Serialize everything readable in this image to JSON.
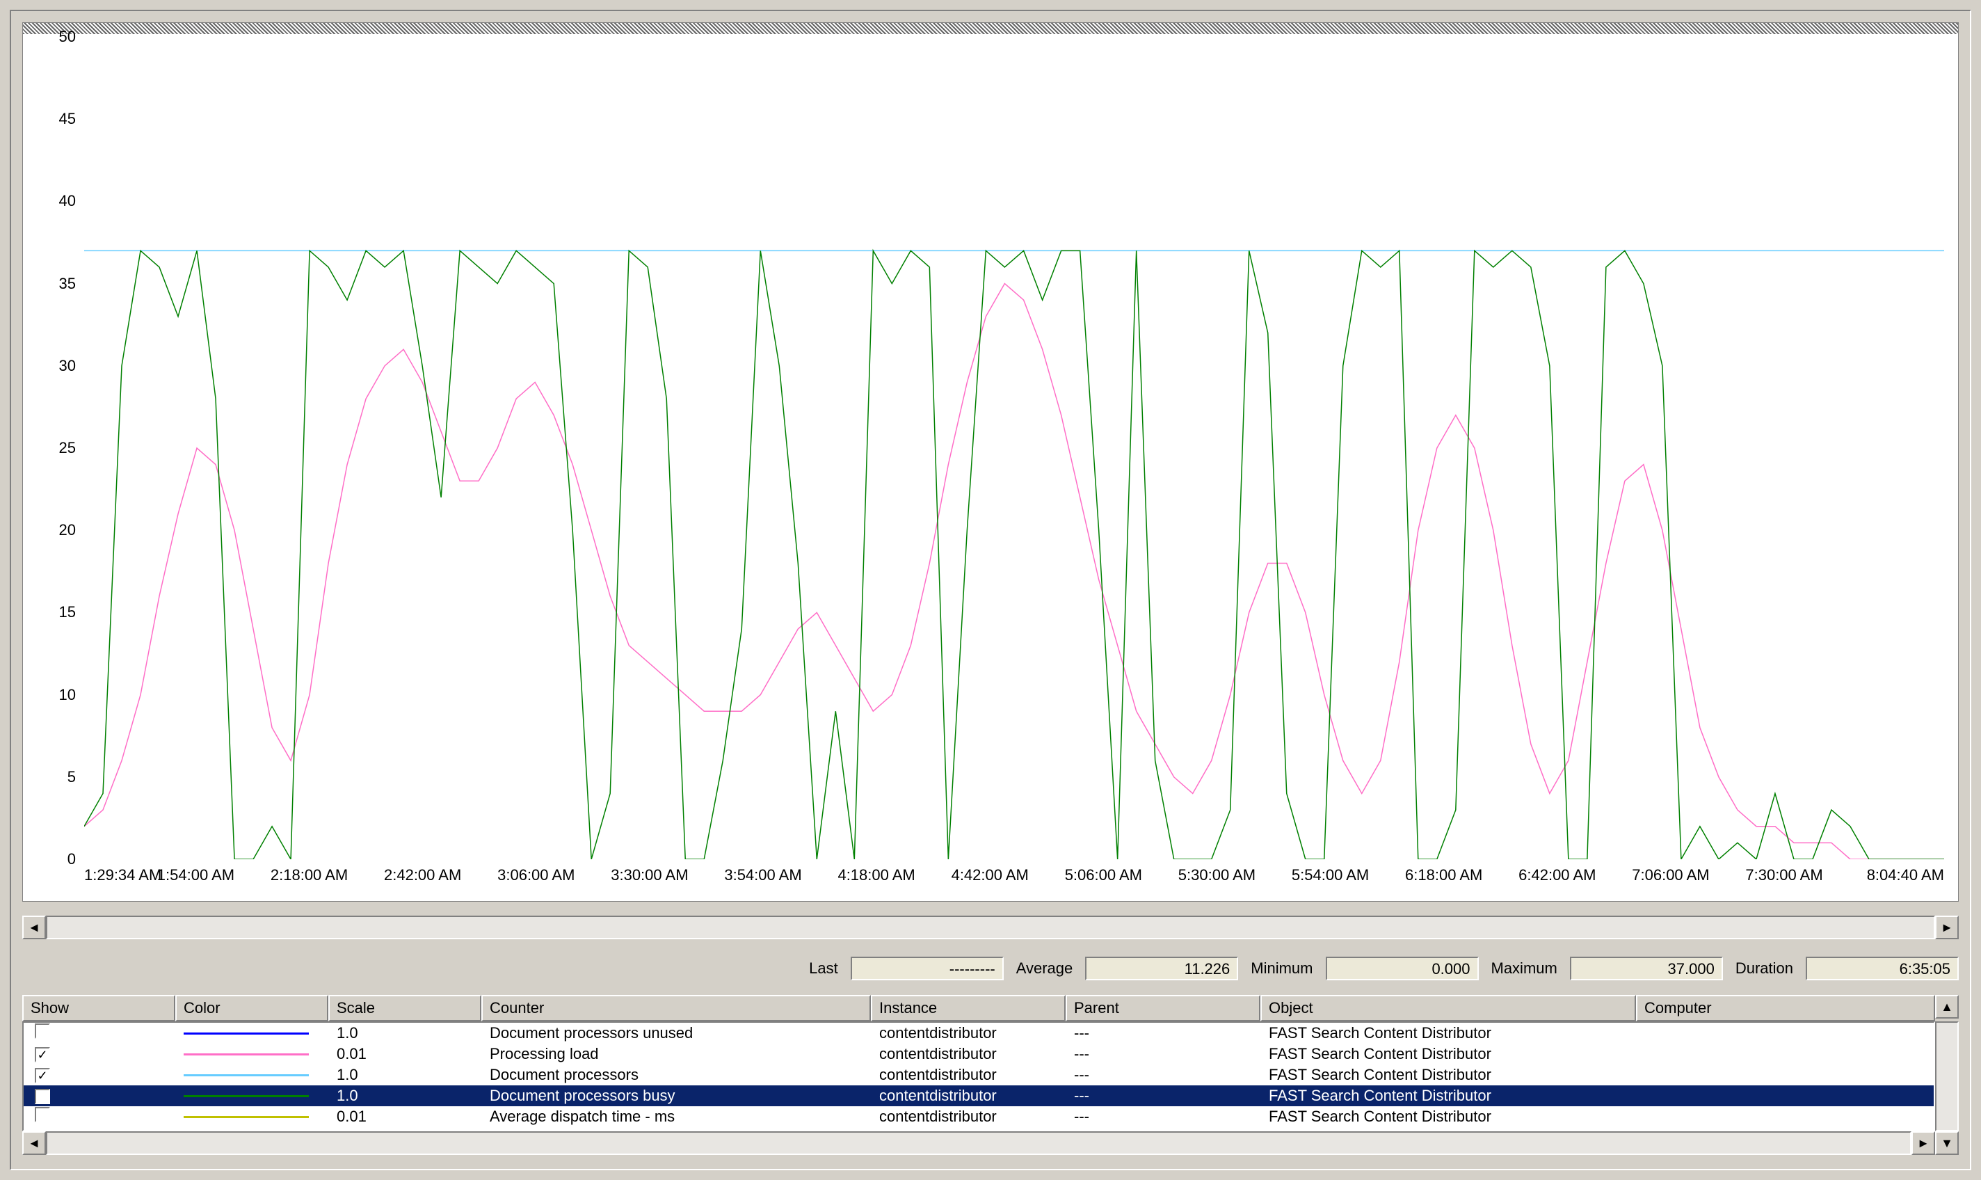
{
  "stats": {
    "last_label": "Last",
    "last_value": "---------",
    "avg_label": "Average",
    "avg_value": "11.226",
    "min_label": "Minimum",
    "min_value": "0.000",
    "max_label": "Maximum",
    "max_value": "37.000",
    "dur_label": "Duration",
    "dur_value": "6:35:05"
  },
  "headers": {
    "show": "Show",
    "color": "Color",
    "scale": "Scale",
    "counter": "Counter",
    "instance": "Instance",
    "parent": "Parent",
    "object": "Object",
    "computer": "Computer"
  },
  "counters": [
    {
      "checked": false,
      "color": "#0000ff",
      "scale": "1.0",
      "counter": "Document processors unused",
      "instance": "contentdistributor",
      "parent": "---",
      "object": "FAST Search Content Distributor",
      "computer": ""
    },
    {
      "checked": true,
      "color": "#ff6ec7",
      "scale": "0.01",
      "counter": "Processing load",
      "instance": "contentdistributor",
      "parent": "---",
      "object": "FAST Search Content Distributor",
      "computer": ""
    },
    {
      "checked": true,
      "color": "#66ccff",
      "scale": "1.0",
      "counter": "Document processors",
      "instance": "contentdistributor",
      "parent": "---",
      "object": "FAST Search Content Distributor",
      "computer": ""
    },
    {
      "checked": true,
      "color": "#008000",
      "scale": "1.0",
      "counter": "Document processors busy",
      "instance": "contentdistributor",
      "parent": "---",
      "object": "FAST Search Content Distributor",
      "computer": "",
      "selected": true
    },
    {
      "checked": false,
      "color": "#c0c000",
      "scale": "0.01",
      "counter": "Average dispatch time - ms",
      "instance": "contentdistributor",
      "parent": "---",
      "object": "FAST Search Content Distributor",
      "computer": ""
    }
  ],
  "yticks": [
    "50",
    "45",
    "40",
    "35",
    "30",
    "25",
    "20",
    "15",
    "10",
    "5",
    "0"
  ],
  "xticks": [
    {
      "label": "1:29:34 AM",
      "pos": 0,
      "cls": "first"
    },
    {
      "label": "1:54:00 AM",
      "pos": 6.0
    },
    {
      "label": "2:18:00 AM",
      "pos": 12.1
    },
    {
      "label": "2:42:00 AM",
      "pos": 18.2
    },
    {
      "label": "3:06:00 AM",
      "pos": 24.3
    },
    {
      "label": "3:30:00 AM",
      "pos": 30.4
    },
    {
      "label": "3:54:00 AM",
      "pos": 36.5
    },
    {
      "label": "4:18:00 AM",
      "pos": 42.6
    },
    {
      "label": "4:42:00 AM",
      "pos": 48.7
    },
    {
      "label": "5:06:00 AM",
      "pos": 54.8
    },
    {
      "label": "5:30:00 AM",
      "pos": 60.9
    },
    {
      "label": "5:54:00 AM",
      "pos": 67.0
    },
    {
      "label": "6:18:00 AM",
      "pos": 73.1
    },
    {
      "label": "6:42:00 AM",
      "pos": 79.2
    },
    {
      "label": "7:06:00 AM",
      "pos": 85.3
    },
    {
      "label": "7:30:00 AM",
      "pos": 91.4
    },
    {
      "label": "8:04:40 AM",
      "pos": 100,
      "cls": "last"
    }
  ],
  "chart_data": {
    "type": "line",
    "ylabel": "",
    "xlabel": "",
    "ylim": [
      0,
      50
    ],
    "x_categories": [
      "1:29:34 AM",
      "1:54:00 AM",
      "2:18:00 AM",
      "2:42:00 AM",
      "3:06:00 AM",
      "3:30:00 AM",
      "3:54:00 AM",
      "4:18:00 AM",
      "4:42:00 AM",
      "5:06:00 AM",
      "5:30:00 AM",
      "5:54:00 AM",
      "6:18:00 AM",
      "6:42:00 AM",
      "7:06:00 AM",
      "7:30:00 AM",
      "8:04:40 AM"
    ],
    "series": [
      {
        "name": "Document processors",
        "color": "#66ccff",
        "values": [
          37,
          37,
          37,
          37,
          37,
          37,
          37,
          37,
          37,
          37,
          37,
          37,
          37,
          37,
          37,
          37,
          37,
          37,
          37,
          37,
          37,
          37,
          37,
          37,
          37,
          37,
          37,
          37,
          37,
          37,
          37,
          37,
          37,
          37,
          37,
          37,
          37,
          37,
          37,
          37,
          37,
          37,
          37,
          37,
          37,
          37,
          37,
          37,
          37,
          37,
          37,
          37,
          37,
          37,
          37,
          37,
          37,
          37,
          37,
          37,
          37,
          37,
          37,
          37,
          37,
          37,
          37,
          37,
          37,
          37,
          37,
          37,
          37,
          37,
          37,
          37,
          37,
          37,
          37,
          37,
          37,
          37,
          37,
          37,
          37,
          37,
          37,
          37,
          37,
          37,
          37,
          37,
          37,
          37,
          37,
          37,
          37,
          37,
          37,
          37
        ]
      },
      {
        "name": "Processing load",
        "color": "#ff6ec7",
        "values": [
          2,
          3,
          6,
          10,
          16,
          21,
          25,
          24,
          20,
          14,
          8,
          6,
          10,
          18,
          24,
          28,
          30,
          31,
          29,
          26,
          23,
          23,
          25,
          28,
          29,
          27,
          24,
          20,
          16,
          13,
          12,
          11,
          10,
          9,
          9,
          9,
          10,
          12,
          14,
          15,
          13,
          11,
          9,
          10,
          13,
          18,
          24,
          29,
          33,
          35,
          34,
          31,
          27,
          22,
          17,
          13,
          9,
          7,
          5,
          4,
          6,
          10,
          15,
          18,
          18,
          15,
          10,
          6,
          4,
          6,
          12,
          20,
          25,
          27,
          25,
          20,
          13,
          7,
          4,
          6,
          12,
          18,
          23,
          24,
          20,
          14,
          8,
          5,
          3,
          2,
          2,
          1,
          1,
          1,
          0,
          0,
          0,
          0,
          0,
          0
        ]
      },
      {
        "name": "Document processors busy",
        "color": "#008000",
        "values": [
          2,
          4,
          30,
          37,
          36,
          33,
          37,
          28,
          0,
          0,
          2,
          0,
          37,
          36,
          34,
          37,
          36,
          37,
          30,
          22,
          37,
          36,
          35,
          37,
          36,
          35,
          20,
          0,
          4,
          37,
          36,
          28,
          0,
          0,
          6,
          14,
          37,
          30,
          18,
          0,
          9,
          0,
          37,
          35,
          37,
          36,
          0,
          20,
          37,
          36,
          37,
          34,
          37,
          37,
          20,
          0,
          37,
          6,
          0,
          0,
          0,
          3,
          37,
          32,
          4,
          0,
          0,
          30,
          37,
          36,
          37,
          0,
          0,
          3,
          37,
          36,
          37,
          36,
          30,
          0,
          0,
          36,
          37,
          35,
          30,
          0,
          2,
          0,
          1,
          0,
          4,
          0,
          0,
          3,
          2,
          0,
          0,
          0,
          0,
          0
        ]
      }
    ]
  }
}
